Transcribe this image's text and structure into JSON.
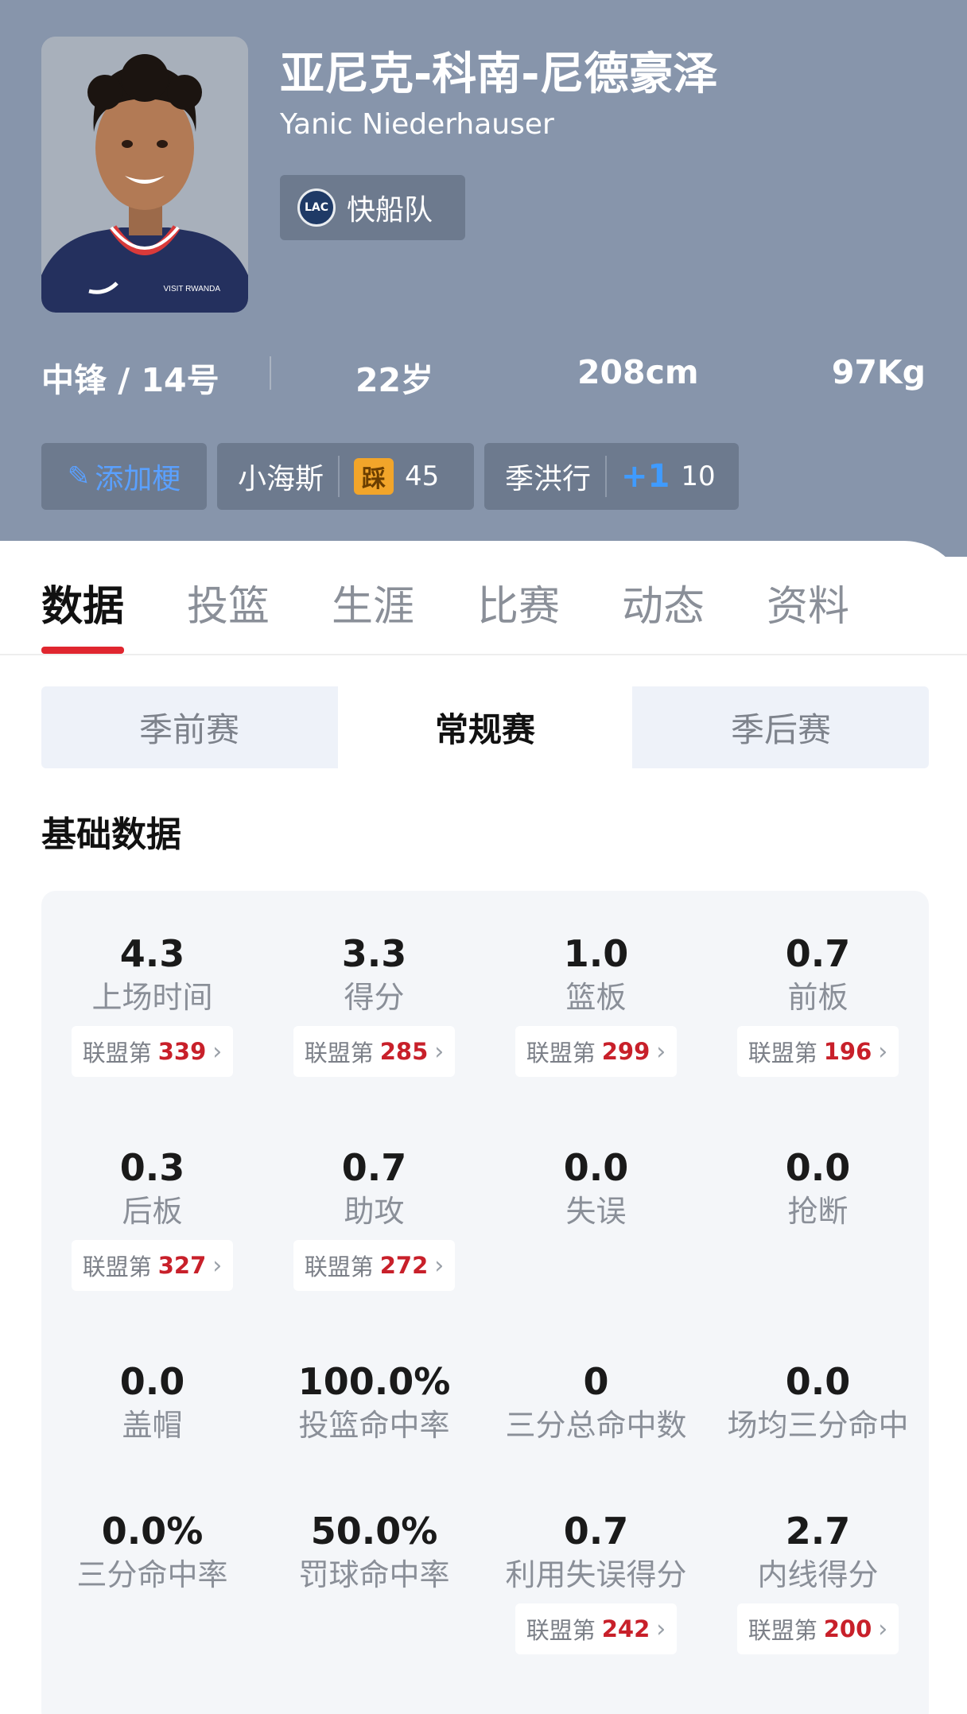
{
  "player": {
    "name_cn": "亚尼克-科南-尼德豪泽",
    "name_en": "Yanic Niederhauser",
    "team": "快船队",
    "team_logo_text": "LAC",
    "jersey_text": "VISIT RWANDA",
    "position_number": "中锋 / 14号",
    "age": "22岁",
    "height": "208cm",
    "weight": "97Kg"
  },
  "tags": {
    "add_label": "添加梗",
    "tag1": {
      "label": "小海斯",
      "icon_text": "踩",
      "count": "45"
    },
    "tag2": {
      "label": "季洪行",
      "icon_text": "+1",
      "count": "10"
    }
  },
  "tabs": [
    "数据",
    "投篮",
    "生涯",
    "比赛",
    "动态",
    "资料"
  ],
  "season_types": [
    "季前赛",
    "常规赛",
    "季后赛"
  ],
  "section_title": "基础数据",
  "rank_prefix": "联盟第",
  "stats": [
    {
      "value": "4.3",
      "label": "上场时间",
      "rank": "339"
    },
    {
      "value": "3.3",
      "label": "得分",
      "rank": "285"
    },
    {
      "value": "1.0",
      "label": "篮板",
      "rank": "299"
    },
    {
      "value": "0.7",
      "label": "前板",
      "rank": "196"
    },
    {
      "value": "0.3",
      "label": "后板",
      "rank": "327"
    },
    {
      "value": "0.7",
      "label": "助攻",
      "rank": "272"
    },
    {
      "value": "0.0",
      "label": "失误"
    },
    {
      "value": "0.0",
      "label": "抢断"
    },
    {
      "value": "0.0",
      "label": "盖帽"
    },
    {
      "value": "100.0%",
      "label": "投篮命中率"
    },
    {
      "value": "0",
      "label": "三分总命中数"
    },
    {
      "value": "0.0",
      "label": "场均三分命中"
    },
    {
      "value": "0.0%",
      "label": "三分命中率"
    },
    {
      "value": "50.0%",
      "label": "罚球命中率"
    },
    {
      "value": "0.7",
      "label": "利用失误得分",
      "rank": "242"
    },
    {
      "value": "2.7",
      "label": "内线得分",
      "rank": "200"
    }
  ],
  "colors": {
    "header_bg": "#8795ab",
    "accent_red": "#e0262f",
    "rank_red": "#c8202a",
    "link_blue": "#5aa0ff"
  }
}
